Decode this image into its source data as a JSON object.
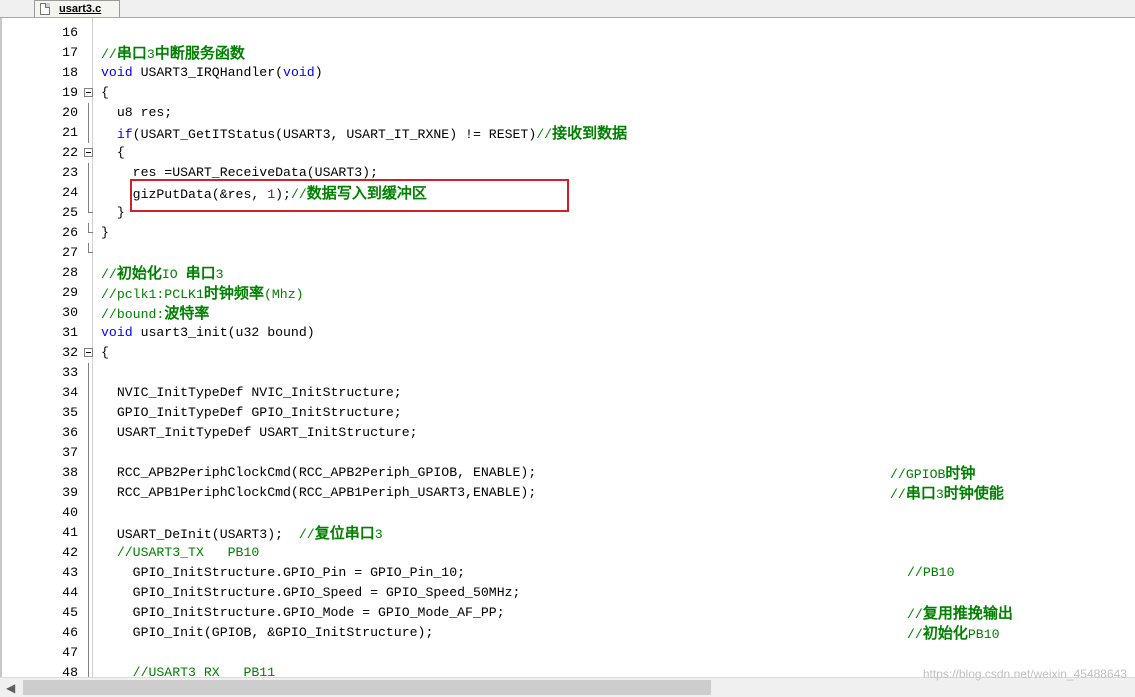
{
  "tab": {
    "label": "usart3.c"
  },
  "lines": [
    {
      "n": "16",
      "c": ""
    },
    {
      "n": "17",
      "c": "//串口3中断服务函数"
    },
    {
      "n": "18",
      "c": "void USART3_IRQHandler(void)"
    },
    {
      "n": "19",
      "c": "{"
    },
    {
      "n": "20",
      "c": "  u8 res;"
    },
    {
      "n": "21",
      "c": "  if(USART_GetITStatus(USART3, USART_IT_RXNE) != RESET)//接收到数据"
    },
    {
      "n": "22",
      "c": "  {"
    },
    {
      "n": "23",
      "c": "    res =USART_ReceiveData(USART3);"
    },
    {
      "n": "24",
      "c": "    gizPutData(&res, 1);//数据写入到缓冲区"
    },
    {
      "n": "25",
      "c": "  }"
    },
    {
      "n": "26",
      "c": "}"
    },
    {
      "n": "27",
      "c": ""
    },
    {
      "n": "28",
      "c": "//初始化IO 串口3"
    },
    {
      "n": "29",
      "c": "//pclk1:PCLK1时钟频率(Mhz)"
    },
    {
      "n": "30",
      "c": "//bound:波特率"
    },
    {
      "n": "31",
      "c": "void usart3_init(u32 bound)"
    },
    {
      "n": "32",
      "c": "{"
    },
    {
      "n": "33",
      "c": ""
    },
    {
      "n": "34",
      "c": "  NVIC_InitTypeDef NVIC_InitStructure;"
    },
    {
      "n": "35",
      "c": "  GPIO_InitTypeDef GPIO_InitStructure;"
    },
    {
      "n": "36",
      "c": "  USART_InitTypeDef USART_InitStructure;"
    },
    {
      "n": "37",
      "c": ""
    },
    {
      "n": "38",
      "c": "  RCC_APB2PeriphClockCmd(RCC_APB2Periph_GPIOB, ENABLE);",
      "t": "//GPIOB时钟"
    },
    {
      "n": "39",
      "c": "  RCC_APB1PeriphClockCmd(RCC_APB1Periph_USART3,ENABLE);",
      "t": "  //串口3时钟使能"
    },
    {
      "n": "40",
      "c": ""
    },
    {
      "n": "41",
      "c": "  USART_DeInit(USART3);  //复位串口3"
    },
    {
      "n": "42",
      "c": "  //USART3_TX   PB10"
    },
    {
      "n": "43",
      "c": "    GPIO_InitStructure.GPIO_Pin = GPIO_Pin_10;",
      "t": "      //PB10"
    },
    {
      "n": "44",
      "c": "    GPIO_InitStructure.GPIO_Speed = GPIO_Speed_50MHz;"
    },
    {
      "n": "45",
      "c": "    GPIO_InitStructure.GPIO_Mode = GPIO_Mode_AF_PP;",
      "t": "      //复用推挽输出"
    },
    {
      "n": "46",
      "c": "    GPIO_Init(GPIOB, &GPIO_InitStructure);",
      "t": "      //初始化PB10"
    },
    {
      "n": "47",
      "c": ""
    },
    {
      "n": "48",
      "c": "    //USART3_RX   PB11"
    }
  ],
  "watermark": "https://blog.csdn.net/weixin_45488643"
}
